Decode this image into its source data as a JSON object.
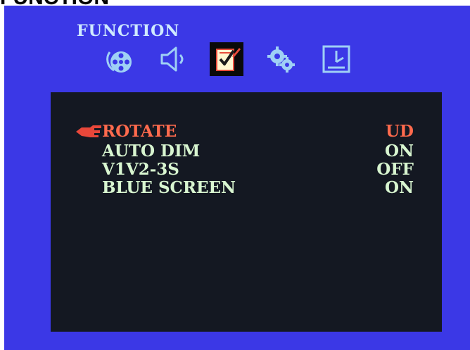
{
  "caption": "FUNCTION",
  "menu": {
    "title": "FUNCTION",
    "tabs": [
      {
        "name": "picture",
        "icon": "film-reel-icon",
        "active": false
      },
      {
        "name": "sound",
        "icon": "speaker-icon",
        "active": false
      },
      {
        "name": "function",
        "icon": "checklist-icon",
        "active": true
      },
      {
        "name": "settings",
        "icon": "gears-icon",
        "active": false
      },
      {
        "name": "timer",
        "icon": "clock-icon",
        "active": false
      }
    ]
  },
  "settings": [
    {
      "label": "ROTATE",
      "value": "UD",
      "selected": true
    },
    {
      "label": "AUTO DIM",
      "value": "ON",
      "selected": false
    },
    {
      "label": "V1V2-3S",
      "value": "OFF",
      "selected": false
    },
    {
      "label": "BLUE SCREEN",
      "value": "ON",
      "selected": false
    }
  ],
  "colors": {
    "screen_background": "#3b38e6",
    "panel_background": "#141822",
    "selected_text": "#ff6a4d",
    "normal_text": "#d8f5d0",
    "title_text": "#cfeaff"
  }
}
